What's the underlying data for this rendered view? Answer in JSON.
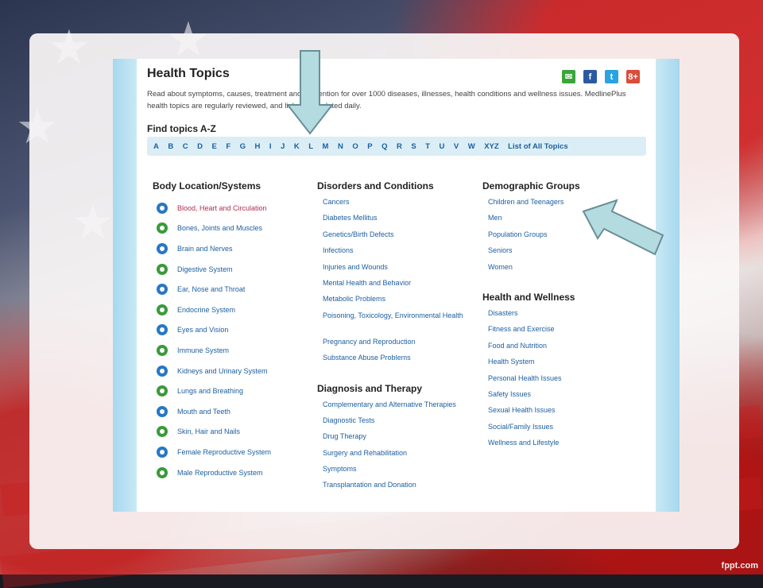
{
  "header": {
    "title": "Health Topics",
    "intro": "Read about symptoms, causes, treatment and prevention for over 1000 diseases, illnesses, health conditions and wellness issues. MedlinePlus health topics are regularly reviewed, and links are updated daily."
  },
  "share": {
    "email_label": "✉",
    "facebook_label": "f",
    "twitter_label": "t",
    "gplus_label": "8+"
  },
  "az": {
    "title": "Find topics A-Z",
    "letters": [
      "A",
      "B",
      "C",
      "D",
      "E",
      "F",
      "G",
      "H",
      "I",
      "J",
      "K",
      "L",
      "M",
      "N",
      "O",
      "P",
      "Q",
      "R",
      "S",
      "T",
      "U",
      "V",
      "W",
      "XYZ"
    ],
    "all_label": "List of All Topics"
  },
  "columns": {
    "body": {
      "heading": "Body Location/Systems",
      "items": [
        "Blood, Heart and Circulation",
        "Bones, Joints and Muscles",
        "Brain and Nerves",
        "Digestive System",
        "Ear, Nose and Throat",
        "Endocrine System",
        "Eyes and Vision",
        "Immune System",
        "Kidneys and Urinary System",
        "Lungs and Breathing",
        "Mouth and Teeth",
        "Skin, Hair and Nails",
        "Female Reproductive System",
        "Male Reproductive System"
      ]
    },
    "disorders": {
      "heading": "Disorders and Conditions",
      "items": [
        "Cancers",
        "Diabetes Mellitus",
        "Genetics/Birth Defects",
        "Infections",
        "Injuries and Wounds",
        "Mental Health and Behavior",
        "Metabolic Problems",
        "Poisoning, Toxicology, Environmental Health",
        "Pregnancy and Reproduction",
        "Substance Abuse Problems"
      ]
    },
    "diagnosis": {
      "heading": "Diagnosis and Therapy",
      "items": [
        "Complementary and Alternative Therapies",
        "Diagnostic Tests",
        "Drug Therapy",
        "Surgery and Rehabilitation",
        "Symptoms",
        "Transplantation and Donation"
      ]
    },
    "demographic": {
      "heading": "Demographic Groups",
      "items": [
        "Children and Teenagers",
        "Men",
        "Population Groups",
        "Seniors",
        "Women"
      ]
    },
    "wellness": {
      "heading": "Health and Wellness",
      "items": [
        "Disasters",
        "Fitness and Exercise",
        "Food and Nutrition",
        "Health System",
        "Personal Health Issues",
        "Safety Issues",
        "Sexual Health Issues",
        "Social/Family Issues",
        "Wellness and Lifestyle"
      ]
    }
  },
  "footer": {
    "logo": "fppt.com"
  }
}
